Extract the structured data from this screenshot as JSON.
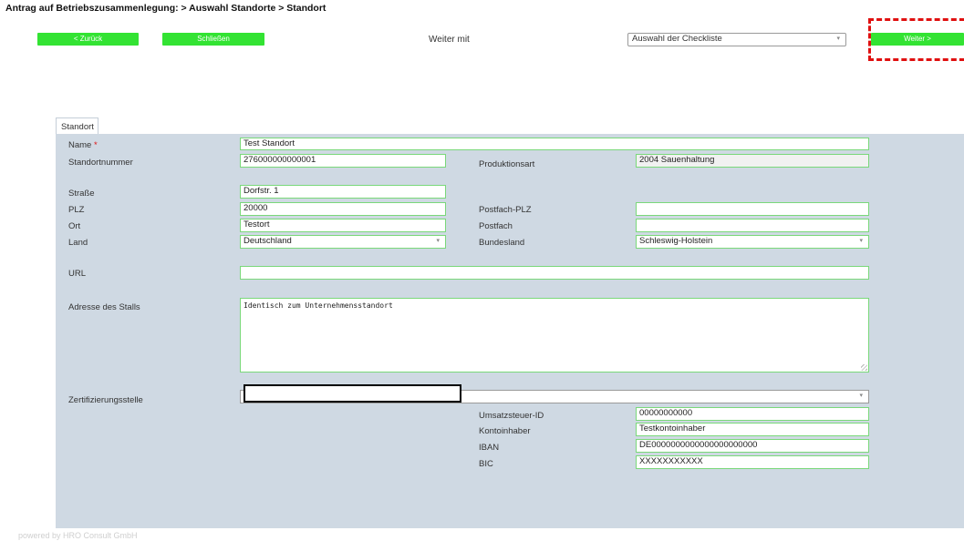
{
  "header": {
    "breadcrumb": "Antrag auf Betriebszusammenlegung: > Auswahl Standorte > Standort"
  },
  "toolbar": {
    "back_label": "< Zurück",
    "close_label": "Schließen",
    "weiter_mit_label": "Weiter mit",
    "weiter_select_value": "Auswahl der Checkliste",
    "next_label": "Weiter >"
  },
  "tab": {
    "label": "Standort"
  },
  "form": {
    "name_label": "Name",
    "name_required": "*",
    "name_value": "Test Standort",
    "standortnummer_label": "Standortnummer",
    "standortnummer_value": "276000000000001",
    "produktionsart_label": "Produktionsart",
    "produktionsart_value": "2004 Sauenhaltung",
    "strasse_label": "Straße",
    "strasse_value": "Dorfstr. 1",
    "plz_label": "PLZ",
    "plz_value": "20000",
    "postfach_plz_label": "Postfach-PLZ",
    "postfach_plz_value": "",
    "ort_label": "Ort",
    "ort_value": "Testort",
    "postfach_label": "Postfach",
    "postfach_value": "",
    "land_label": "Land",
    "land_value": "Deutschland",
    "bundesland_label": "Bundesland",
    "bundesland_value": "Schleswig-Holstein",
    "url_label": "URL",
    "url_value": "",
    "adresse_label": "Adresse des Stalls",
    "adresse_value": "Identisch zum Unternehmensstandort",
    "zert_label": "Zertifizierungsstelle",
    "zert_value": "",
    "ust_label": "Umsatzsteuer-ID",
    "ust_value": "00000000000",
    "kontoinhaber_label": "Kontoinhaber",
    "kontoinhaber_value": "Testkontoinhaber",
    "iban_label": "IBAN",
    "iban_value": "DE0000000000000000000000",
    "bic_label": "BIC",
    "bic_value": "XXXXXXXXXXX"
  },
  "footer": {
    "text": "powered by HRO Consult GmbH"
  },
  "icons": {
    "dropdown_arrow": "▾"
  },
  "colors": {
    "accent_green": "#33e333",
    "panel_bg": "#cfd9e3",
    "highlight_red": "#e01010"
  }
}
